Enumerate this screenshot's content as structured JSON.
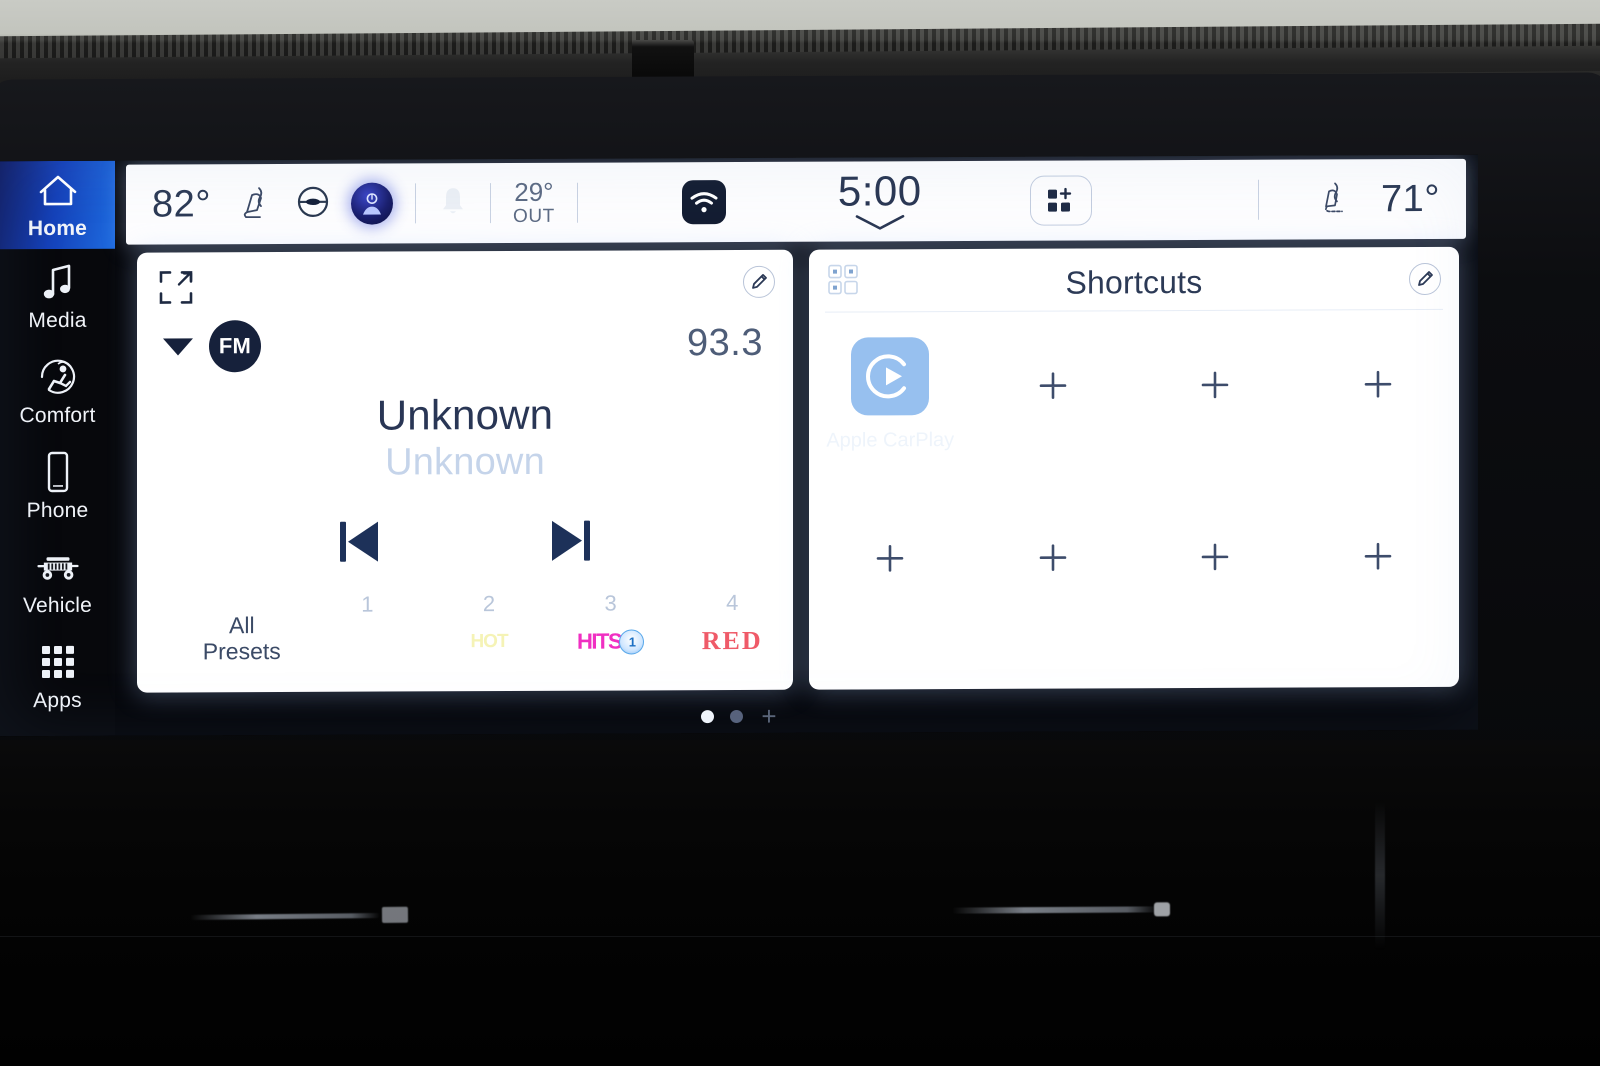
{
  "sidebar": {
    "items": [
      {
        "label": "Home",
        "icon": "home-icon",
        "active": true
      },
      {
        "label": "Media",
        "icon": "music-note-icon",
        "active": false
      },
      {
        "label": "Comfort",
        "icon": "comfort-seat-icon",
        "active": false
      },
      {
        "label": "Phone",
        "icon": "phone-icon",
        "active": false
      },
      {
        "label": "Vehicle",
        "icon": "vehicle-icon",
        "active": false
      },
      {
        "label": "Apps",
        "icon": "apps-grid-icon",
        "active": false
      }
    ]
  },
  "statusbar": {
    "driver_temp": "82°",
    "heated_seat_icon": "heated-seat-icon",
    "heated_wheel_icon": "heated-steering-wheel-icon",
    "profile_icon": "driver-profile-icon",
    "bell_icon": "notification-bell-icon",
    "outside_temp_value": "29°",
    "outside_temp_label": "OUT",
    "wifi_icon": "wifi-icon",
    "clock": "5:00",
    "clock_chevron_icon": "chevron-down-icon",
    "app_shortcut_icon": "add-app-grid-icon",
    "passenger_seat_icon": "heated-seat-icon",
    "passenger_temp": "71°"
  },
  "radio_card": {
    "expand_icon": "expand-fullscreen-icon",
    "edit_icon": "edit-pencil-icon",
    "band_caret_icon": "caret-down-icon",
    "band": "FM",
    "frequency": "93.3",
    "track_title": "Unknown",
    "track_artist": "Unknown",
    "prev_icon": "previous-track-icon",
    "next_icon": "next-track-icon",
    "all_presets_line1": "All",
    "all_presets_line2": "Presets",
    "presets": [
      {
        "number": "1",
        "logo_text": "",
        "logo_kind": "none"
      },
      {
        "number": "2",
        "logo_text": "HOT",
        "logo_kind": "hot"
      },
      {
        "number": "3",
        "logo_text": "HITS",
        "logo_kind": "hits",
        "badge": "1"
      },
      {
        "number": "4",
        "logo_text": "RED",
        "logo_kind": "red"
      }
    ]
  },
  "shortcuts_card": {
    "grid_icon": "shortcuts-grid-icon",
    "title": "Shortcuts",
    "edit_icon": "edit-pencil-icon",
    "row1": [
      {
        "type": "app",
        "label": "Apple CarPlay",
        "icon": "apple-carplay-icon"
      },
      {
        "type": "empty",
        "label": "+"
      },
      {
        "type": "empty",
        "label": "+"
      },
      {
        "type": "empty",
        "label": "+"
      }
    ],
    "row2": [
      {
        "type": "empty",
        "label": "+"
      },
      {
        "type": "empty",
        "label": "+"
      },
      {
        "type": "empty",
        "label": "+"
      },
      {
        "type": "empty",
        "label": "+"
      }
    ]
  },
  "pager": {
    "pages": 2,
    "active_index": 0,
    "add_label": "+"
  },
  "colors": {
    "accent_blue": "#1440b8",
    "ink": "#27354f",
    "card_bg": "#ffffff",
    "screen_bg": "#05060a",
    "carplay_tile": "#97c0ef",
    "preset_red": "#ef5a68",
    "preset_hits": "#f02fc2"
  }
}
